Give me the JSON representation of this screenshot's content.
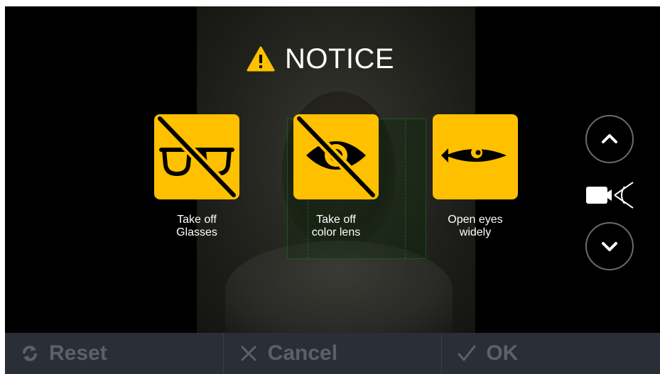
{
  "notice": {
    "title": "NOTICE",
    "icon": "warning-icon"
  },
  "instructions": [
    {
      "icon": "no-glasses-icon",
      "line1": "Take off",
      "line2": "Glasses"
    },
    {
      "icon": "no-color-lens-icon",
      "line1": "Take off",
      "line2": "color lens"
    },
    {
      "icon": "open-eye-icon",
      "line1": "Open eyes",
      "line2": "widely"
    }
  ],
  "side_controls": {
    "up_icon": "chevron-up-icon",
    "switch_icon": "camera-switch-icon",
    "down_icon": "chevron-down-icon"
  },
  "toolbar": {
    "reset_label": "Reset",
    "cancel_label": "Cancel",
    "ok_label": "OK"
  },
  "colors": {
    "accent": "#ffc000",
    "toolbar_bg": "#2a2e36",
    "toolbar_text": "#5d6068"
  }
}
